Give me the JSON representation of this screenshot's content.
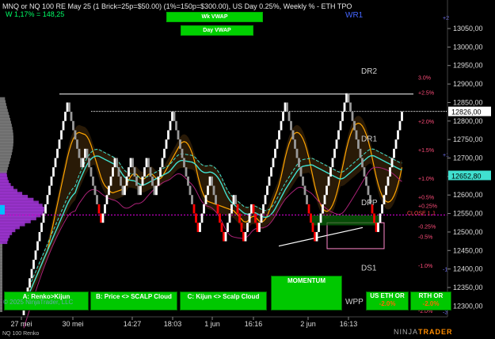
{
  "header": {
    "title": "MNQ or NQ 100 RE May 25 (1 Brick=25p=$50.00) (1%=150p=$300.00), US Day 0.25%, Weekly % - ETH TPO",
    "subtitle": "W 1,17% = 148,25",
    "wk_vwap": "Wk VWAP",
    "day_vwap": "Day VWAP"
  },
  "buttons": {
    "a": "A: Renko>Kijun",
    "b": "B: Price <> SCALP Cloud",
    "c": "C: Kijun <> Scalp Cloud",
    "momentum": "MOMENTUM",
    "eth_or_label": "US ETH OR",
    "eth_or_value": "-2.0%",
    "rth_or_label": "RTH OR",
    "rth_or_value": "-2.0%"
  },
  "copyright": "© 2025 NinjaTrader, LLC",
  "footer_left": "NQ 100 Renko",
  "brand": {
    "pre": "NINJA",
    "post": "TRADER"
  },
  "colors": {
    "background": "#000000",
    "bull_brick": "#ffffff",
    "bear_brick": "#ff0000",
    "neutral_brick": "#9a9a9a",
    "kijun": "#ffa500",
    "cloud_line": "#40e0d0",
    "poc_line": "#cc00cc",
    "volume_profile": "#9933cc",
    "current_price_label": "#ffffff"
  },
  "chart_data": {
    "type": "renko",
    "x_ticks": [
      "27 mei",
      "30 mei",
      "14:27",
      "18:03",
      "1 jun",
      "16:16",
      "2 jun",
      "16:13"
    ],
    "ylim": [
      12275,
      13110
    ],
    "y_ticks": [
      12300,
      12350,
      12400,
      12450,
      12500,
      12550,
      12600,
      12650,
      12700,
      12750,
      12800,
      12850,
      12900,
      12950,
      13000,
      13050
    ],
    "y_tick_labels": [
      "12300,00",
      "12350,00",
      "12400,00",
      "12450,00",
      "12500,00",
      "12550,00",
      "12600,00",
      "12650,00",
      "12700,00",
      "12750,00",
      "12800,00",
      "12850,00",
      "12900,00",
      "12950,00",
      "13000,00",
      "13050,00"
    ],
    "current_price": "12826,00",
    "current_price_value": 12826,
    "second_price_label": "12652,80",
    "second_price_value": 12653,
    "weekly_pct_labels": [
      {
        "label": "3.0%",
        "value": 12918
      },
      {
        "label": "+2.5%",
        "value": 12878
      },
      {
        "label": "+2.0%",
        "value": 12800
      },
      {
        "label": "+1.5%",
        "value": 12722
      },
      {
        "label": "+1.0%",
        "value": 12645
      },
      {
        "label": "+0.5%",
        "value": 12595
      },
      {
        "label": "+0.25%",
        "value": 12572
      },
      {
        "label": "-0.25%",
        "value": 12516
      },
      {
        "label": "-0.5%",
        "value": 12488
      },
      {
        "label": "-1.0%",
        "value": 12410
      },
      {
        "label": "-1.5%",
        "value": 12335
      },
      {
        "label": "-2.0%",
        "value": 12288
      }
    ],
    "day_pct_labels": [
      {
        "label": "+2",
        "value": 13080
      },
      {
        "label": "+1",
        "value": 12710
      },
      {
        "label": "-1",
        "value": 12400
      },
      {
        "label": "-2",
        "value": 12310
      },
      {
        "label": "-3",
        "value": 12285
      }
    ],
    "level_labels": [
      {
        "label": "WR1",
        "value": 13080
      },
      {
        "label": "DR2",
        "value": 12928
      },
      {
        "label": "DR1",
        "value": 12745
      },
      {
        "label": "DPP",
        "value": 12573
      },
      {
        "label": "CLOSE 1 J",
        "value": 12546
      },
      {
        "label": "DS1",
        "value": 12396
      },
      {
        "label": "WPP",
        "value": 12305
      }
    ],
    "resistance_level": 12873,
    "current_level_line": 12826,
    "poc_level": 12546,
    "renko_x": [
      4,
      5,
      6,
      7,
      8,
      9,
      10,
      11,
      12,
      13,
      14,
      15,
      16,
      17,
      18,
      19,
      20,
      21,
      22,
      23,
      24,
      25,
      26,
      27,
      28,
      29,
      30,
      31,
      32,
      33,
      34,
      35,
      36,
      37,
      38,
      39,
      40,
      41,
      42,
      43,
      44,
      45,
      46,
      47,
      48,
      49,
      50,
      51,
      52,
      53,
      54,
      55,
      56,
      57,
      58,
      59,
      60,
      61,
      62,
      63,
      64,
      65,
      66,
      67,
      68,
      69,
      70,
      71,
      72,
      73,
      74,
      75,
      76,
      77,
      78,
      79,
      80,
      81,
      82,
      83,
      84,
      85,
      86,
      87,
      88,
      89,
      90,
      91,
      92,
      93,
      94,
      95,
      96,
      97,
      98,
      99,
      100,
      101,
      102,
      103,
      104,
      105,
      106,
      107,
      108,
      109,
      110,
      111,
      112,
      113,
      114,
      115,
      116,
      117,
      118,
      119,
      120,
      121,
      122,
      123,
      124,
      125,
      126,
      127,
      128,
      129,
      130,
      131,
      132,
      133,
      134,
      135,
      136,
      137,
      138,
      139,
      140,
      141,
      142,
      143,
      144,
      145,
      146,
      147,
      148,
      149,
      150,
      151,
      152,
      153,
      154,
      155,
      156,
      157,
      158,
      159,
      160,
      161,
      162,
      163,
      164,
      165,
      166,
      167,
      168,
      169,
      170,
      171,
      172,
      173,
      174,
      175,
      176,
      177,
      178,
      179,
      180,
      181,
      182,
      183,
      184,
      185,
      186,
      187,
      188,
      189,
      190,
      191,
      192,
      193,
      194,
      195
    ],
    "renko_close": [
      12300,
      12325,
      12350,
      12375,
      12400,
      12425,
      12450,
      12475,
      12500,
      12525,
      12550,
      12575,
      12600,
      12625,
      12650,
      12675,
      12700,
      12725,
      12750,
      12775,
      12800,
      12825,
      12850,
      12825,
      12800,
      12775,
      12750,
      12725,
      12700,
      12675,
      12700,
      12725,
      12700,
      12675,
      12650,
      12625,
      12600,
      12575,
      12550,
      12525,
      12550,
      12575,
      12600,
      12625,
      12650,
      12675,
      12700,
      12675,
      12650,
      12625,
      12600,
      12625,
      12650,
      12675,
      12700,
      12675,
      12650,
      12625,
      12600,
      12625,
      12650,
      12675,
      12700,
      12675,
      12650,
      12625,
      12600,
      12625,
      12650,
      12675,
      12700,
      12725,
      12750,
      12775,
      12800,
      12825,
      12800,
      12775,
      12750,
      12725,
      12700,
      12675,
      12650,
      12625,
      12600,
      12575,
      12550,
      12525,
      12500,
      12525,
      12550,
      12575,
      12600,
      12625,
      12650,
      12625,
      12600,
      12575,
      12550,
      12525,
      12500,
      12475,
      12500,
      12525,
      12550,
      12575,
      12600,
      12575,
      12550,
      12525,
      12500,
      12475,
      12500,
      12525,
      12550,
      12575,
      12550,
      12525,
      12500,
      12525,
      12550,
      12575,
      12600,
      12625,
      12650,
      12675,
      12700,
      12725,
      12750,
      12775,
      12800,
      12825,
      12850,
      12825,
      12800,
      12775,
      12750,
      12725,
      12700,
      12675,
      12650,
      12625,
      12600,
      12575,
      12550,
      12525,
      12500,
      12475,
      12500,
      12525,
      12550,
      12575,
      12600,
      12625,
      12650,
      12675,
      12700,
      12725,
      12750,
      12775,
      12800,
      12825,
      12850,
      12875,
      12850,
      12825,
      12800,
      12775,
      12750,
      12725,
      12700,
      12675,
      12650,
      12625,
      12600,
      12575,
      12550,
      12525,
      12500,
      12525,
      12550,
      12575,
      12600,
      12625,
      12650,
      12675,
      12700,
      12725,
      12750,
      12775,
      12800,
      12825
    ]
  }
}
